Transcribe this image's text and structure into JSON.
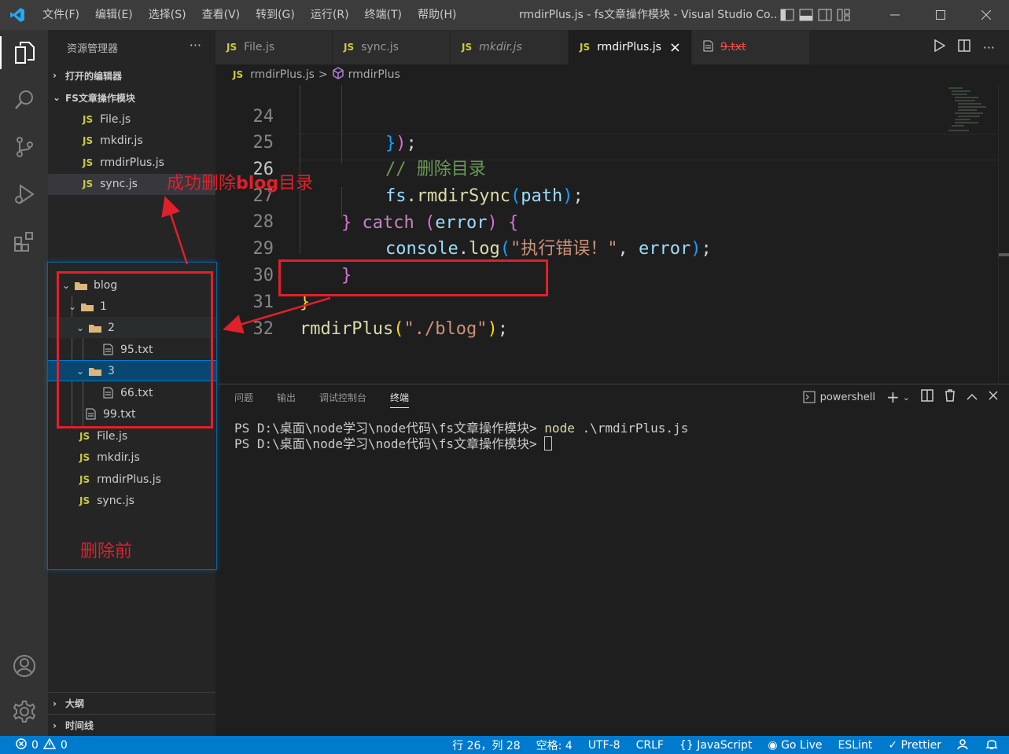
{
  "window": {
    "title": "rmdirPlus.js - fs文章操作模块 - Visual Studio Co...",
    "menu": [
      "文件(F)",
      "编辑(E)",
      "选择(S)",
      "查看(V)",
      "转到(G)",
      "运行(R)",
      "终端(T)",
      "帮助(H)"
    ]
  },
  "activity": [
    "explorer-icon",
    "search-icon",
    "source-control-icon",
    "run-debug-icon",
    "extensions-icon",
    "account-icon",
    "settings-gear-icon"
  ],
  "sidebar": {
    "header": "资源管理器",
    "more": "···",
    "open_editors": "打开的编辑器",
    "folder": "FS文章操作模块",
    "files": [
      {
        "icon": "JS",
        "name": "File.js"
      },
      {
        "icon": "JS",
        "name": "mkdir.js"
      },
      {
        "icon": "JS",
        "name": "rmdirPlus.js"
      },
      {
        "icon": "JS",
        "name": "sync.js"
      }
    ],
    "outline": "大纲",
    "timeline": "时间线"
  },
  "before_panel": {
    "tree": [
      {
        "type": "folder",
        "name": "blog",
        "level": 0
      },
      {
        "type": "folder",
        "name": "1",
        "level": 1
      },
      {
        "type": "folder",
        "name": "2",
        "level": 2
      },
      {
        "type": "file",
        "name": "95.txt",
        "level": 3
      },
      {
        "type": "folder",
        "name": "3",
        "level": 2
      },
      {
        "type": "file",
        "name": "66.txt",
        "level": 3
      },
      {
        "type": "file",
        "name": "99.txt",
        "level": 2
      }
    ],
    "js_files": [
      {
        "icon": "JS",
        "name": "File.js"
      },
      {
        "icon": "JS",
        "name": "mkdir.js"
      },
      {
        "icon": "JS",
        "name": "rmdirPlus.js"
      },
      {
        "icon": "JS",
        "name": "sync.js"
      }
    ]
  },
  "tabs": [
    {
      "icon": "JS",
      "label": "File.js",
      "active": false,
      "italic": false
    },
    {
      "icon": "JS",
      "label": "sync.js",
      "active": false,
      "italic": false
    },
    {
      "icon": "JS",
      "label": "mkdir.js",
      "active": false,
      "italic": true
    },
    {
      "icon": "JS",
      "label": "rmdirPlus.js",
      "active": true,
      "italic": false,
      "close": "×"
    },
    {
      "icon": "file-icon",
      "label": "9.txt",
      "active": false,
      "italic": false,
      "deleted": true
    }
  ],
  "breadcrumb": {
    "file_icon": "JS",
    "file": "rmdirPlus.js",
    "sep": ">",
    "symbol": "rmdirPlus"
  },
  "editor": {
    "lines": [
      {
        "n": "24",
        "text": "});"
      },
      {
        "n": "25",
        "text": "// 删除目录"
      },
      {
        "n": "26",
        "text": "fs.rmdirSync(path);"
      },
      {
        "n": "27",
        "text": "} catch (error) {"
      },
      {
        "n": "28",
        "text": "console.log(\"执行错误！\", error);"
      },
      {
        "n": "29",
        "text": "}"
      },
      {
        "n": "30",
        "text": "}"
      },
      {
        "n": "31",
        "text": "rmdirPlus(\"./blog\");"
      },
      {
        "n": "32",
        "text": ""
      }
    ]
  },
  "panel": {
    "tabs": [
      "问题",
      "输出",
      "调试控制台",
      "终端"
    ],
    "active_tab": "终端",
    "shell": "powershell",
    "terminal": [
      {
        "prompt": "PS D:\\桌面\\node学习\\node代码\\fs文章操作模块> ",
        "cmd": "node",
        "args": " .\\rmdirPlus.js"
      },
      {
        "prompt": "PS D:\\桌面\\node学习\\node代码\\fs文章操作模块> ",
        "cmd": "",
        "args": ""
      }
    ]
  },
  "statusbar": {
    "errors": "0",
    "warnings": "0",
    "position": "行 26，列 28",
    "spaces": "空格: 4",
    "encoding": "UTF-8",
    "eol": "CRLF",
    "language": "JavaScript",
    "golive": "Go Live",
    "eslint": "ESLint",
    "prettier": "Prettier"
  },
  "annotations": {
    "success_prefix": "成功删除",
    "success_bold": "blog",
    "success_suffix": "目录",
    "before": "删除前"
  },
  "colors": {
    "accent": "#007acc",
    "annotation_red": "#e0202a",
    "js_yellow": "#cbcb41"
  }
}
